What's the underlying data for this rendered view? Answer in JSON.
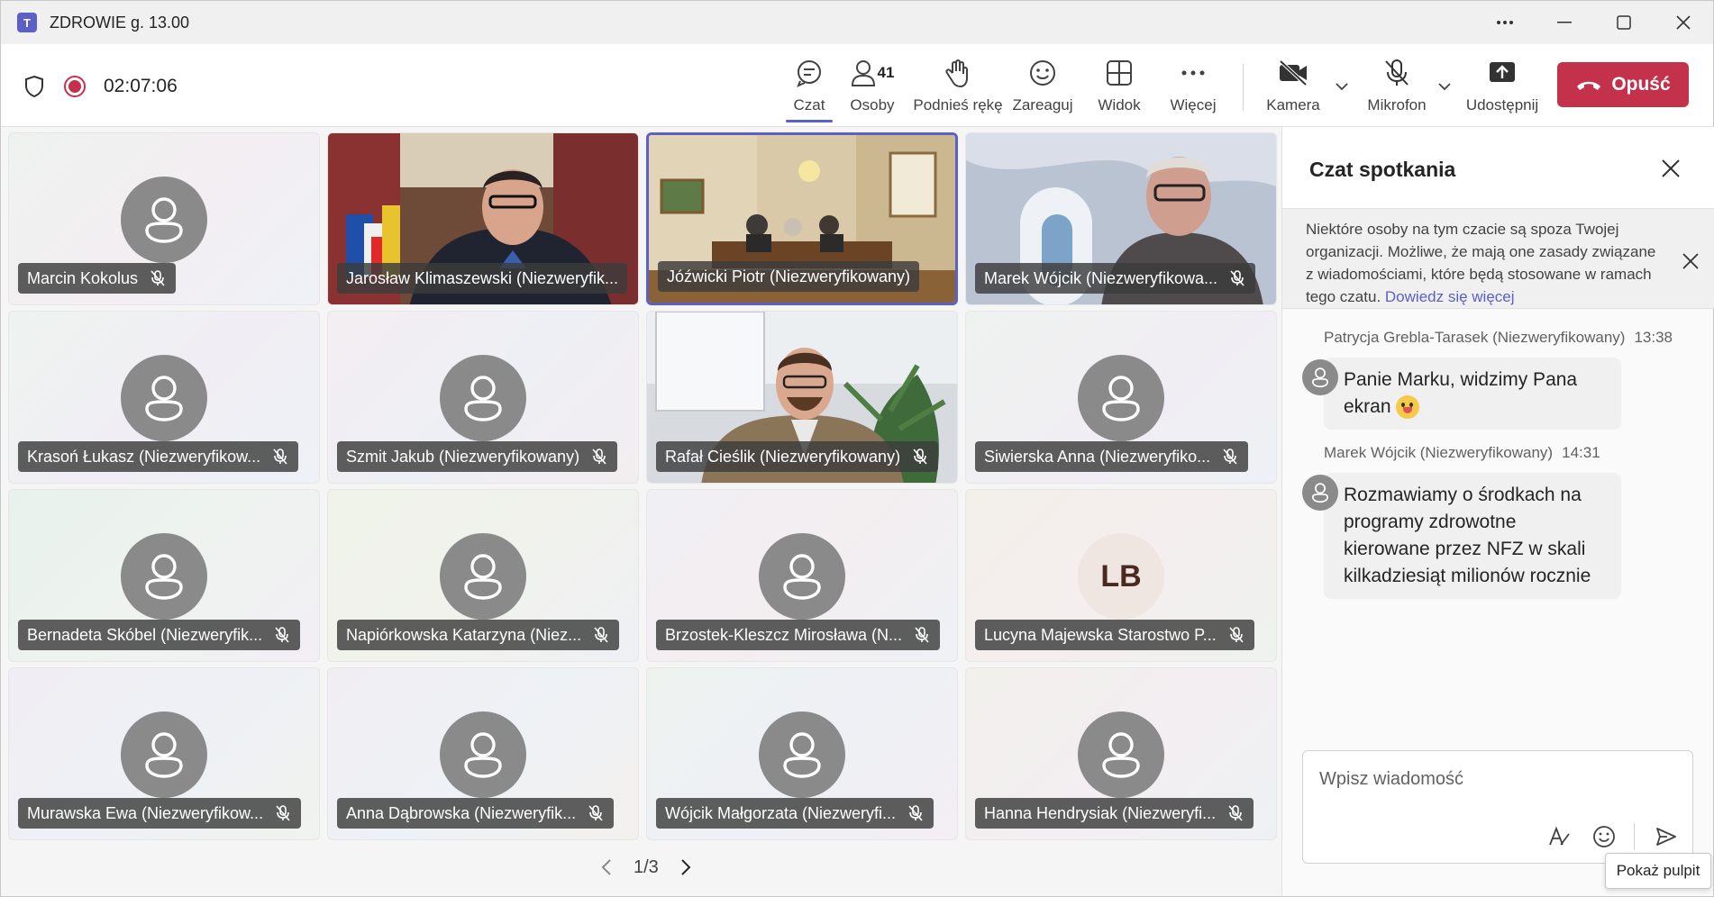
{
  "window": {
    "app_icon": "teams-icon",
    "title": "ZDROWIE g. 13.00"
  },
  "toolbar": {
    "timer": "02:07:06",
    "chat_label": "Czat",
    "people_label": "Osoby",
    "people_count": "41",
    "raise_hand_label": "Podnieś rękę",
    "react_label": "Zareaguj",
    "view_label": "Widok",
    "more_label": "Więcej",
    "camera_label": "Kamera",
    "mic_label": "Mikrofon",
    "share_label": "Udostępnij",
    "leave_label": "Opuść",
    "leave_color": "#c4314b",
    "accent_color": "#5b5fc7"
  },
  "participants": [
    {
      "name": "Marcin Kokolus"
    },
    {
      "name": "Jarosław Klimaszewski (Niezweryfik..."
    },
    {
      "name": "Jóźwicki Piotr (Niezweryfikowany)"
    },
    {
      "name": "Marek Wójcik (Niezweryfikowa..."
    },
    {
      "name": "Krasoń Łukasz (Niezweryfikow..."
    },
    {
      "name": "Szmit Jakub (Niezweryfikowany)"
    },
    {
      "name": "Rafał Cieślik (Niezweryfikowany)"
    },
    {
      "name": "Siwierska Anna (Niezweryfiko..."
    },
    {
      "name": "Bernadeta Skóbel (Niezweryfik..."
    },
    {
      "name": "Napiórkowska Katarzyna (Niez..."
    },
    {
      "name": "Brzostek-Kleszcz Mirosława (N..."
    },
    {
      "name": "Lucyna Majewska Starostwo P...",
      "initials": "LB"
    },
    {
      "name": "Murawska Ewa (Niezweryfikow..."
    },
    {
      "name": "Anna Dąbrowska (Niezweryfik..."
    },
    {
      "name": "Wójcik Małgorzata (Niezweryfi..."
    },
    {
      "name": "Hanna Hendrysiak (Niezweryfi..."
    }
  ],
  "pager": {
    "label": "1/3"
  },
  "chat": {
    "title": "Czat spotkania",
    "notice": "Niektóre osoby na tym czacie są spoza Twojej organizacji. Możliwe, że mają one zasady związane z wiadomościami, które będą stosowane w ramach tego czatu.",
    "notice_link": "Dowiedz się więcej",
    "messages": [
      {
        "author": "Patrycja Grebla-Tarasek (Niezweryfikowany)",
        "time": "13:38",
        "text": "Panie Marku, widzimy Pana ekran"
      },
      {
        "author": "Marek Wójcik (Niezweryfikowany)",
        "time": "14:31",
        "text": "Rozmawiamy o środkach na programy zdrowotne kierowane przez  NFZ w skali kilkadziesiąt milionów  rocznie"
      }
    ],
    "composer_placeholder": "Wpisz wiadomość"
  },
  "tooltip": {
    "label": "Pokaż pulpit"
  }
}
